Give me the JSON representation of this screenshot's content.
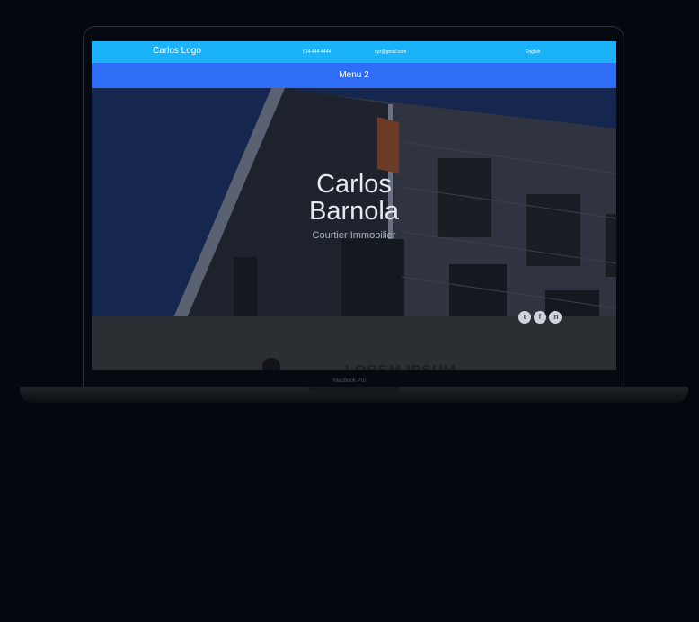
{
  "device": {
    "model_label": "MacBook Pro"
  },
  "header": {
    "logo": "Carlos Logo",
    "phone": "514-444-4444",
    "email": "xyz@gmail.com",
    "language": "English"
  },
  "menu": {
    "item": "Menu 2"
  },
  "hero": {
    "title_line1": "Carlos",
    "title_line2": "Barnola",
    "subtitle": "Courtier Immobilier"
  },
  "social": [
    {
      "icon": "twitter-icon",
      "glyph": "t"
    },
    {
      "icon": "facebook-icon",
      "glyph": "f"
    },
    {
      "icon": "linkedin-icon",
      "glyph": "in"
    }
  ],
  "section": {
    "title": "LOREM IPSUM"
  },
  "colors": {
    "topbar": "#1ab3fa",
    "menubar": "#2f6df6",
    "page_bg": "#02080d"
  }
}
